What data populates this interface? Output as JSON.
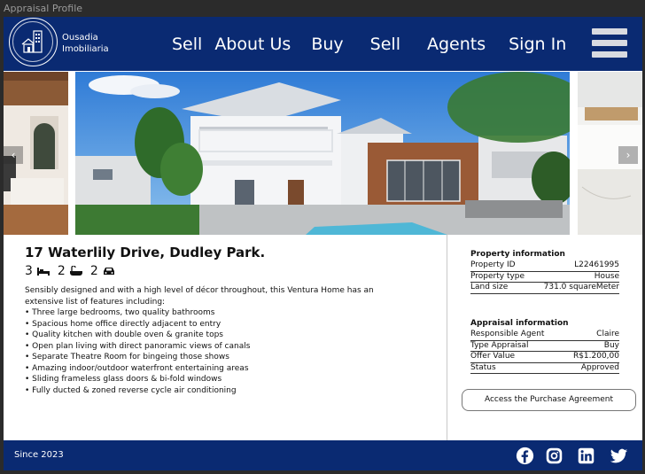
{
  "window": {
    "title": "Appraisal Profile"
  },
  "brand": {
    "line1": "Ousadia",
    "line2": "Imobiliaria"
  },
  "nav": {
    "items": [
      "Sell",
      "About Us",
      "Buy",
      "Sell",
      "Agents",
      "Sign In"
    ]
  },
  "property": {
    "address": "17 Waterlily Drive, Dudley Park.",
    "bedrooms": "3",
    "bathrooms": "2",
    "parking": "2",
    "intro": "Sensibly designed and with a high level of décor throughout, this Ventura Home has an extensive list of features including:",
    "features": [
      "• Three large bedrooms, two quality bathrooms",
      "• Spacious home office directly adjacent to entry",
      "• Quality kitchen with double oven & granite tops",
      "• Open plan living with direct panoramic views of canals",
      "• Separate Theatre Room for bingeing those shows",
      "• Amazing indoor/outdoor waterfront entertaining areas",
      "• Sliding frameless glass doors & bi-fold windows",
      "• Fully ducted & zoned reverse cycle air conditioning"
    ]
  },
  "property_info": {
    "heading": "Property information",
    "rows": [
      {
        "label": "Property ID",
        "value": "L22461995"
      },
      {
        "label": "Property type",
        "value": "House"
      },
      {
        "label": "Land size",
        "value": "731.0 squareMeter"
      }
    ]
  },
  "appraisal_info": {
    "heading": "Appraisal information",
    "rows": [
      {
        "label": "Responsible Agent",
        "value": "Claire"
      },
      {
        "label": "Type Appraisal",
        "value": "Buy"
      },
      {
        "label": "Offer Value",
        "value": "R$1.200,00"
      },
      {
        "label": "Status",
        "value": "Approved"
      }
    ]
  },
  "actions": {
    "purchase_agreement": "Access the Purchase Agreement"
  },
  "footer": {
    "since": "Since 2023"
  },
  "carousel": {
    "prev_icon": "chevron-left-icon",
    "next_icon": "chevron-right-icon"
  },
  "colors": {
    "primary": "#0a2a72",
    "header_text": "#ffffff"
  }
}
